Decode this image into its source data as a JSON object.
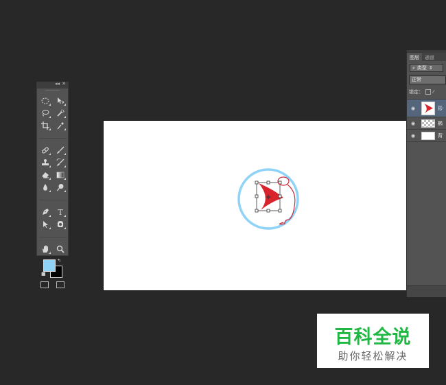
{
  "toolbox": {
    "tools": [
      {
        "icon": "elliptical-marquee-icon"
      },
      {
        "icon": "move-artboard-icon"
      },
      {
        "icon": "lasso-icon"
      },
      {
        "icon": "quick-selection-icon"
      },
      {
        "icon": "crop-icon"
      },
      {
        "icon": "eyedropper-icon"
      },
      {
        "icon": "spot-healing-icon"
      },
      {
        "icon": "brush-icon"
      },
      {
        "icon": "clone-stamp-icon"
      },
      {
        "icon": "history-brush-icon"
      },
      {
        "icon": "eraser-icon"
      },
      {
        "icon": "gradient-icon"
      },
      {
        "icon": "blur-icon"
      },
      {
        "icon": "dodge-icon"
      },
      {
        "icon": "pen-icon"
      },
      {
        "icon": "type-icon",
        "text": "T"
      },
      {
        "icon": "path-selection-icon"
      },
      {
        "icon": "custom-shape-icon"
      },
      {
        "icon": "hand-icon"
      },
      {
        "icon": "zoom-icon"
      }
    ],
    "foreground_color": "#8fd3f7",
    "background_color": "#000000"
  },
  "layers_panel": {
    "tabs": [
      "图层",
      "通道"
    ],
    "filter_label": "类型",
    "blend_mode": "正常",
    "lock_label": "锁定：",
    "layers": [
      {
        "name": "形",
        "selected": true
      },
      {
        "name": "椭",
        "selected": false
      },
      {
        "name": "背",
        "selected": false
      }
    ]
  },
  "watermark": {
    "title": "百科全说",
    "subtitle": "助你轻松解决"
  }
}
